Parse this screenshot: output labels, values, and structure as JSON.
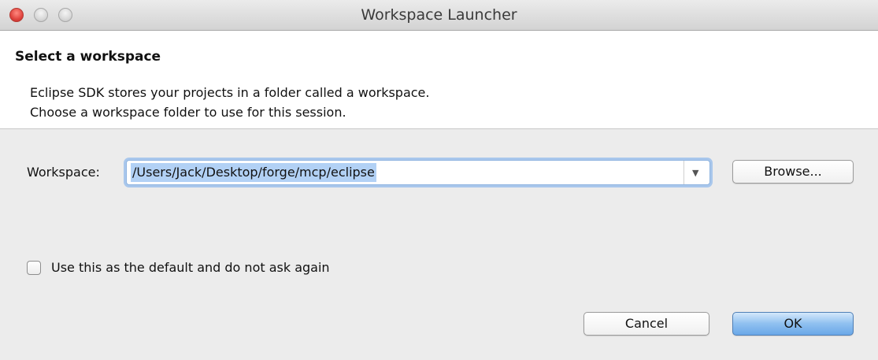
{
  "window": {
    "title": "Workspace Launcher"
  },
  "header": {
    "title": "Select a workspace",
    "description_lines": [
      "Eclipse SDK stores your projects in a folder called a workspace.",
      "Choose a workspace folder to use for this session."
    ]
  },
  "workspace": {
    "label": "Workspace:",
    "value": "/Users/Jack/Desktop/forge/mcp/eclipse",
    "browse_label": "Browse..."
  },
  "default_option": {
    "label": "Use this as the default and do not ask again",
    "checked": false
  },
  "buttons": {
    "cancel": "Cancel",
    "ok": "OK"
  },
  "colors": {
    "close_button": "#e0443e",
    "selection_highlight": "#b2d1f5",
    "focus_ring": "#a9c7ec",
    "ok_button": "#6aa8e8"
  },
  "icons": {
    "close": "close-icon",
    "minimize": "minimize-icon",
    "zoom": "zoom-icon",
    "dropdown": "chevron-down-icon",
    "checkbox": "checkbox-icon"
  }
}
